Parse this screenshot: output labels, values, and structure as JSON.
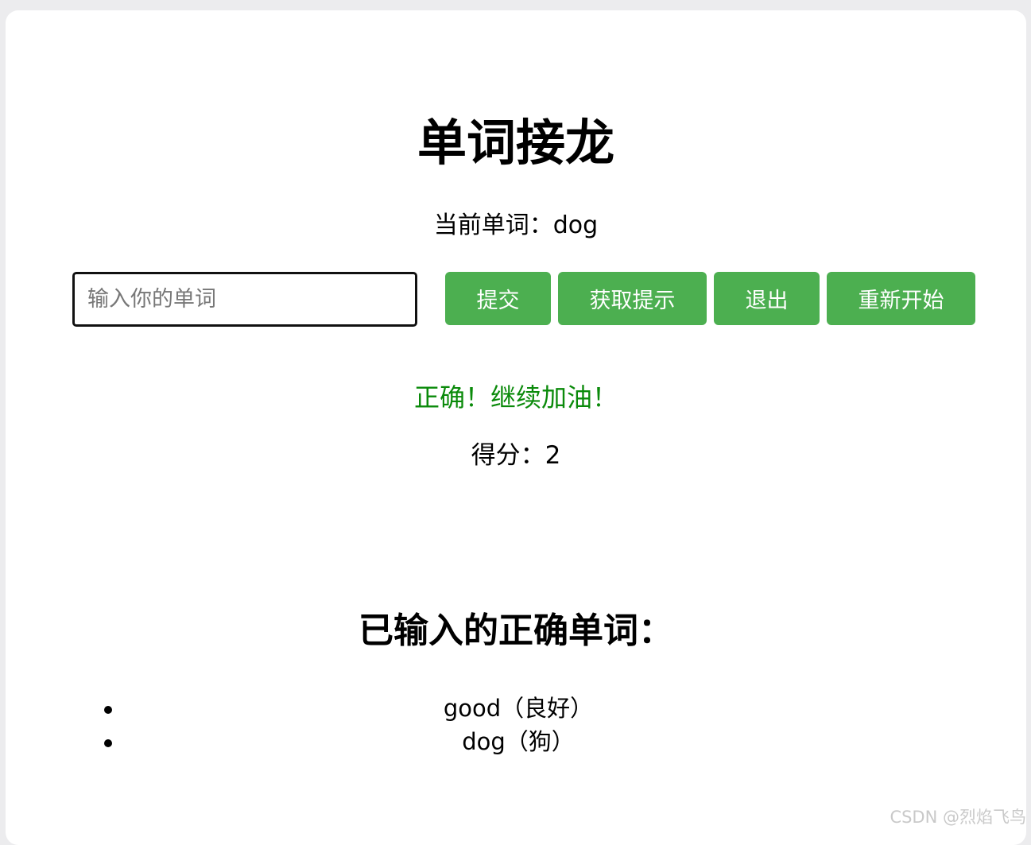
{
  "title": "单词接龙",
  "current_word": "当前单词：dog",
  "input": {
    "placeholder": "输入你的单词",
    "value": ""
  },
  "buttons": {
    "submit": "提交",
    "hint": "获取提示",
    "exit": "退出",
    "restart": "重新开始"
  },
  "feedback": "正确！继续加油！",
  "score": "得分：2",
  "history": {
    "heading": "已输入的正确单词：",
    "items": [
      {
        "text": "good（良好）"
      },
      {
        "text": "dog（狗）"
      }
    ]
  },
  "watermark": "CSDN @烈焰飞鸟",
  "colors": {
    "button_bg": "#4caf50",
    "feedback_text": "#0a8a0a"
  }
}
